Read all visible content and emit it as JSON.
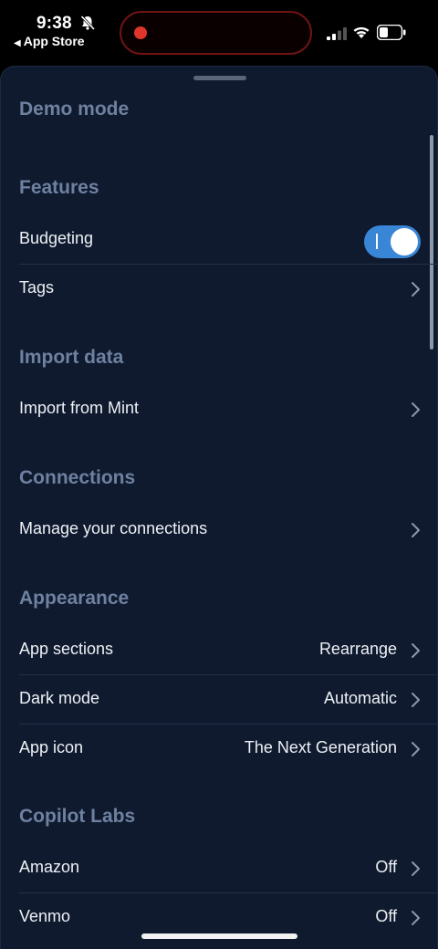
{
  "status_bar": {
    "time": "9:38",
    "back_app": "App Store"
  },
  "settings": {
    "demo_mode": "Demo mode",
    "features": {
      "title": "Features",
      "budgeting_label": "Budgeting",
      "budgeting_on": true,
      "tags_label": "Tags"
    },
    "import_data": {
      "title": "Import data",
      "import_mint_label": "Import from Mint"
    },
    "connections": {
      "title": "Connections",
      "manage_label": "Manage your connections"
    },
    "appearance": {
      "title": "Appearance",
      "app_sections_label": "App sections",
      "app_sections_value": "Rearrange",
      "dark_mode_label": "Dark mode",
      "dark_mode_value": "Automatic",
      "app_icon_label": "App icon",
      "app_icon_value": "The Next Generation"
    },
    "copilot_labs": {
      "title": "Copilot Labs",
      "amazon_label": "Amazon",
      "amazon_value": "Off",
      "venmo_label": "Venmo",
      "venmo_value": "Off"
    }
  },
  "colors": {
    "background": "#0f1a2e",
    "section_title": "#6f81a0",
    "toggle_on": "#3a86d6",
    "recording": "#e0352b"
  },
  "icons": {
    "chevron": "chevron-right-icon",
    "bell": "bell-slash-icon",
    "signal": "cellular-signal-icon",
    "wifi": "wifi-icon",
    "battery": "battery-icon"
  }
}
